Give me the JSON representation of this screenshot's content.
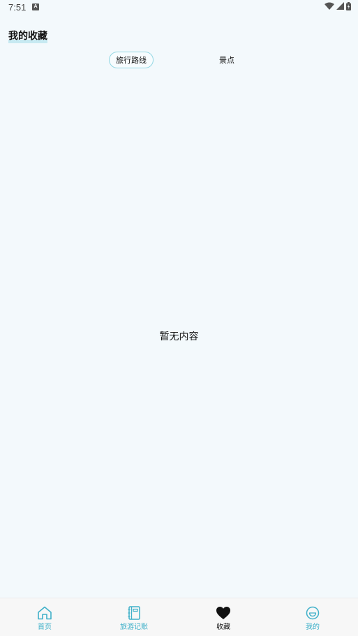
{
  "status_bar": {
    "time": "7:51",
    "notification_icon": "a-letter-icon",
    "icons": [
      "wifi-icon",
      "signal-icon",
      "battery-icon"
    ]
  },
  "header": {
    "title": "我的收藏"
  },
  "tabs": [
    {
      "label": "旅行路线",
      "selected": true
    },
    {
      "label": "景点",
      "selected": false
    }
  ],
  "content": {
    "empty_text": "暂无内容"
  },
  "bottom_nav": {
    "items": [
      {
        "label": "首页",
        "icon": "home-icon",
        "active": false
      },
      {
        "label": "旅游记账",
        "icon": "notebook-icon",
        "active": false
      },
      {
        "label": "收藏",
        "icon": "heart-icon",
        "active": true
      },
      {
        "label": "我的",
        "icon": "smiley-icon",
        "active": false
      }
    ]
  },
  "colors": {
    "background": "#f3f9fc",
    "accent": "#3fb0c9",
    "tab_border": "#93d7e3",
    "title_underline": "#c7eaf2",
    "active_nav": "#111111"
  }
}
